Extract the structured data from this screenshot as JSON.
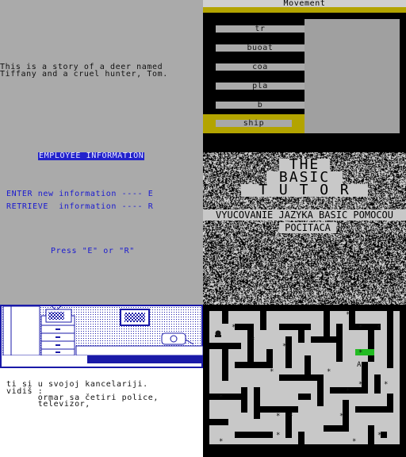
{
  "story": {
    "line1": "This is a story of a deer named",
    "line2": "Tiffany and a cruel hunter, Tom."
  },
  "movement": {
    "header": "Movement",
    "items": [
      "tr",
      "buoat",
      "coa",
      "pla",
      "b"
    ],
    "selected": "ship"
  },
  "employee": {
    "title": "EMPLOYEE INFORMATION",
    "enter": "ENTER new information ---- E",
    "retrieve": "RETRIEVE  information ---- R",
    "prompt": "Press \"E\" or \"R\""
  },
  "tutor": {
    "title1": "THE",
    "title2": "BASIC",
    "title3": "T U T O R",
    "subtitle1": "VYUCOVANIE JAZYKA BASIC POMOCOU",
    "subtitle2": "POCITACA"
  },
  "office": {
    "line1": "ti si u svojoj kancelariji.",
    "line2": "vidiš :",
    "line3": "      ormar sa četiri police,",
    "line4": "      televizor,"
  },
  "maze": {
    "symbols": [
      "*",
      "A"
    ],
    "colors": {
      "wall": "#000000",
      "floor": "#c8c8c8",
      "exit": "#22bb22"
    }
  }
}
